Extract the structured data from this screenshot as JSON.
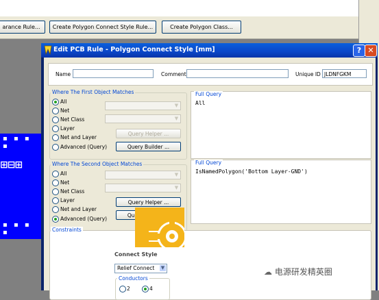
{
  "background": {
    "buttons": [
      {
        "label": "arance Rule..."
      },
      {
        "label": "Create Polygon Connect Style Rule..."
      },
      {
        "label": "Create Polygon Class..."
      }
    ]
  },
  "dialog": {
    "title": "Edit PCB Rule - Polygon Connect Style [mm]",
    "help_label": "?",
    "close_label": "✕",
    "name_label": "Name",
    "name_value": "",
    "comment_label": "Comment",
    "comment_value": "",
    "uid_label": "Unique ID",
    "uid_value": "JLDNFGKM",
    "first_match": {
      "title": "Where The First Object Matches",
      "options": [
        "All",
        "Net",
        "Net Class",
        "Layer",
        "Net and Layer",
        "Advanced (Query)"
      ],
      "selected": "All",
      "query_helper": "Query Helper ...",
      "query_builder": "Query Builder ...",
      "full_query_title": "Full Query",
      "full_query": "All"
    },
    "second_match": {
      "title": "Where The Second Object Matches",
      "options": [
        "All",
        "Net",
        "Net Class",
        "Layer",
        "Net and Layer",
        "Advanced (Query)"
      ],
      "selected": "Advanced (Query)",
      "query_helper": "Query Helper ...",
      "query_builder": "Query Builder ...",
      "full_query_title": "Full Query",
      "full_query": "IsNamedPolygon('Bottom Layer-GND')"
    },
    "constraints": {
      "title": "Constraints",
      "connect_style_label": "Connect Style",
      "connect_style_value": "Relief Connect",
      "conductors_title": "Conductors",
      "conductor_options": [
        "2",
        "4"
      ],
      "conductor_selected": "4"
    }
  },
  "watermark": "电源研发精英圈",
  "colors": {
    "accent": "#0046d5",
    "pcb_blue": "#0000ff",
    "connect_fill": "#f4b41a"
  }
}
